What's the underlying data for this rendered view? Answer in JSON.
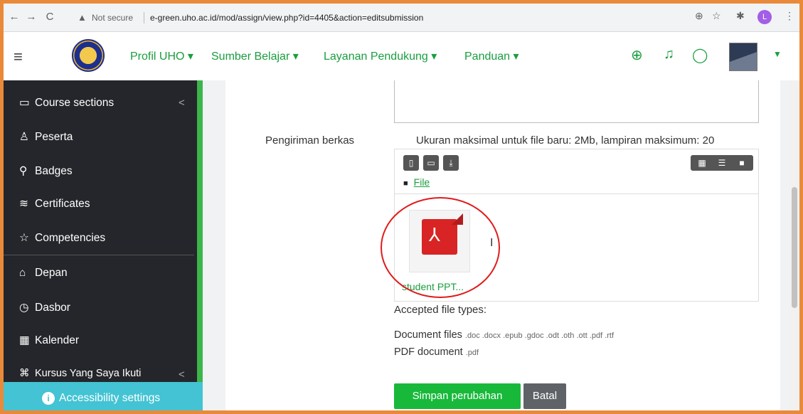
{
  "browser": {
    "security_label": "Not secure",
    "url": "e-green.uho.ac.id/mod/assign/view.php?id=4405&action=editsubmission",
    "profile_initial": "L"
  },
  "topnav": {
    "menu": [
      {
        "label": "Profil UHO"
      },
      {
        "label": "Sumber Belajar"
      },
      {
        "label": "Layanan Pendukung"
      },
      {
        "label": "Panduan"
      }
    ]
  },
  "sidebar": {
    "items": [
      {
        "label": "Course sections",
        "icon": "folder-icon"
      },
      {
        "label": "Peserta",
        "icon": "users-icon"
      },
      {
        "label": "Badges",
        "icon": "badge-icon"
      },
      {
        "label": "Certificates",
        "icon": "certificate-icon"
      },
      {
        "label": "Competencies",
        "icon": "star-icon"
      },
      {
        "label": "Depan",
        "icon": "home-icon"
      },
      {
        "label": "Dasbor",
        "icon": "dashboard-icon"
      },
      {
        "label": "Kalender",
        "icon": "calendar-icon"
      },
      {
        "label": "Kursus Yang Saya Ikuti",
        "icon": "graduation-icon"
      }
    ],
    "accessibility_label": "Accessibility settings"
  },
  "form": {
    "file_submission_label": "Pengiriman berkas",
    "limits_text": "Ukuran maksimal untuk file baru: 2Mb, lampiran maksimum: 20",
    "path_label": "File",
    "file_name": "student PPT...",
    "accepted_title": "Accepted file types:",
    "file_types": [
      {
        "label": "Document files",
        "exts": ".doc .docx .epub .gdoc .odt .oth .ott .pdf .rtf"
      },
      {
        "label": "PDF document",
        "exts": ".pdf"
      }
    ],
    "save_label": "Simpan perubahan",
    "cancel_label": "Batal"
  },
  "colors": {
    "brand_green": "#1a9e3f",
    "sidebar_bg": "#25262b",
    "accessibility_bg": "#43c3d3",
    "save_button": "#18b93b",
    "annotation_circle": "#e01b1b"
  }
}
